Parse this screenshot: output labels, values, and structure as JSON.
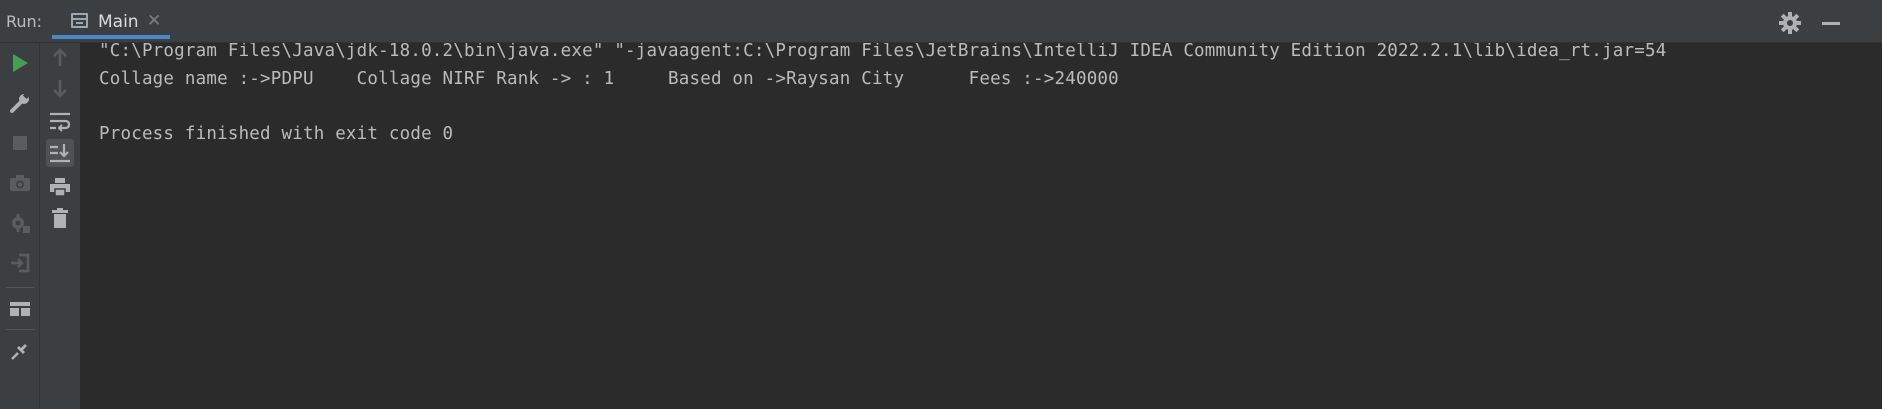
{
  "header": {
    "run_label": "Run:",
    "tab": {
      "icon": "console-window-icon",
      "label": "Main",
      "close": "✕"
    },
    "right_icons": [
      "gear-icon",
      "minimize-icon"
    ]
  },
  "toolbar_left": {
    "items": [
      "rerun-icon",
      "wrench-icon",
      "stop-icon",
      "camera-icon",
      "debug-settings-icon",
      "exit-icon",
      "layout-icon",
      "pin-icon"
    ]
  },
  "toolbar_second": {
    "items": [
      "arrow-up-icon",
      "arrow-down-icon",
      "soft-wrap-icon",
      "scroll-to-end-icon",
      "print-icon",
      "trash-icon"
    ]
  },
  "console": {
    "lines": [
      "\"C:\\Program Files\\Java\\jdk-18.0.2\\bin\\java.exe\" \"-javaagent:C:\\Program Files\\JetBrains\\IntelliJ IDEA Community Edition 2022.2.1\\lib\\idea_rt.jar=54",
      "Collage name :->PDPU    Collage NIRF Rank -> : 1     Based on ->Raysan City      Fees :->240000",
      "",
      "Process finished with exit code 0"
    ]
  },
  "colors": {
    "background": "#2b2b2b",
    "panel": "#3c3f41",
    "text": "#bbbbbb",
    "accent_tab": "#4a88c7",
    "run_green": "#499c54"
  }
}
